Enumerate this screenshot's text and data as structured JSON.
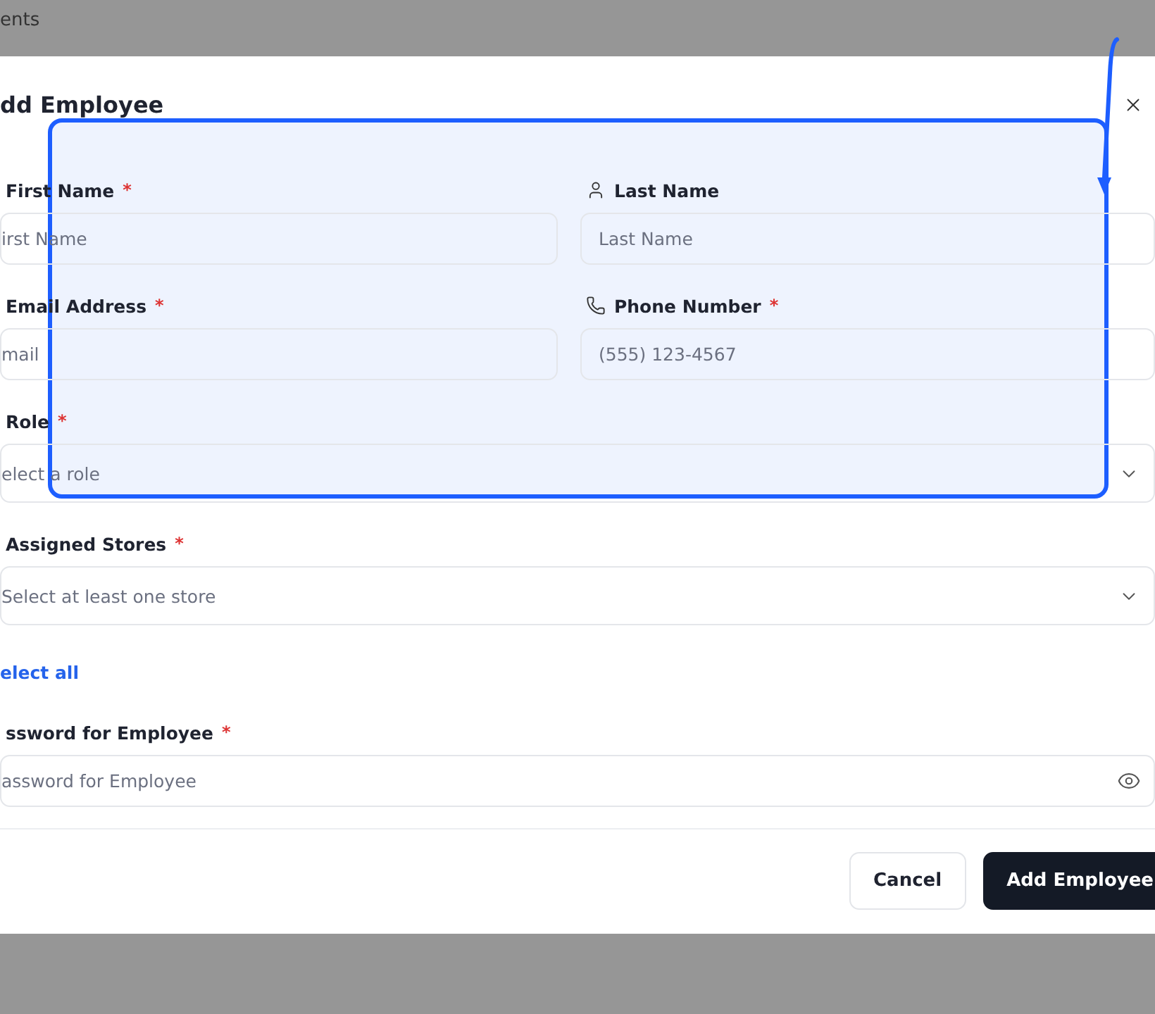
{
  "backdrop": {
    "heading": "ents"
  },
  "dialog": {
    "title": "dd Employee",
    "rows": [
      [
        {
          "kind": "text",
          "label": "First Name",
          "required_mark": "*",
          "placeholder": "irst Name"
        },
        {
          "kind": "person",
          "label": "Last Name",
          "placeholder": "Last Name"
        }
      ],
      [
        {
          "kind": "text",
          "label": "Email Address",
          "required_mark": "*",
          "placeholder": "mail"
        },
        {
          "kind": "phone",
          "label": "Phone Number",
          "required_mark": "*",
          "placeholder": "(555) 123-4567"
        }
      ],
      [
        {
          "kind": "select",
          "label": "Role",
          "required_mark": "*",
          "placeholder": "elect a role"
        }
      ],
      [
        {
          "kind": "select",
          "label": "Assigned Stores",
          "required_mark": "*",
          "placeholder": "Select at least one store"
        }
      ],
      [
        {
          "kind": "link",
          "label": "elect all"
        }
      ],
      [
        {
          "kind": "password",
          "label": "ssword for Employee",
          "required_mark": "*",
          "placeholder": "assword for Employee"
        }
      ]
    ],
    "buttons": [
      {
        "kind": "secondary",
        "label": "Cancel"
      },
      {
        "kind": "primary",
        "label": "Add Employee"
      }
    ]
  }
}
